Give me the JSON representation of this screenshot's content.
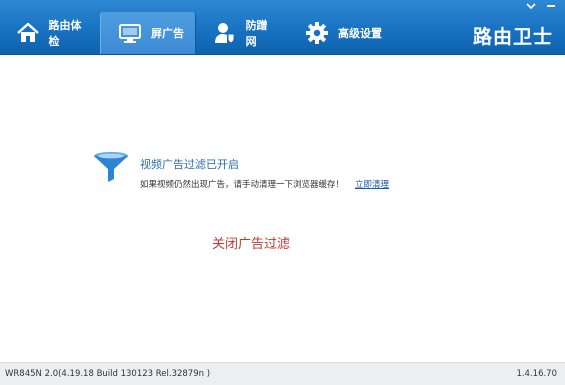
{
  "window": {
    "minimize_icon": "minimize-icon",
    "close_icon": "close-icon"
  },
  "header": {
    "brand": "路由卫士",
    "tabs": [
      {
        "label": "路由体检",
        "icon": "home-icon",
        "active": false
      },
      {
        "label": "屏广告",
        "icon": "monitor-icon",
        "active": true
      },
      {
        "label": "防蹭网",
        "icon": "user-shield-icon",
        "active": false
      },
      {
        "label": "高级设置",
        "icon": "gear-icon",
        "active": false
      }
    ],
    "colors": {
      "bar": "#1872c2",
      "active_tab": "#3b8ad4"
    }
  },
  "main": {
    "status_icon": "filter-icon",
    "status_title": "视频广告过滤已开启",
    "hint": "如果视频仍然出现广告，请手动清理一下浏览器缓存！",
    "hint_link": "立即清理",
    "close_filter": "关闭广告过滤",
    "colors": {
      "title": "#2a6bb0",
      "link": "#1a55b8",
      "close": "#c0392b"
    }
  },
  "footer": {
    "firmware": "WR845N 2.0(4.19.18 Build 130123 Rel.32879n )",
    "version": "1.4.16.70"
  }
}
